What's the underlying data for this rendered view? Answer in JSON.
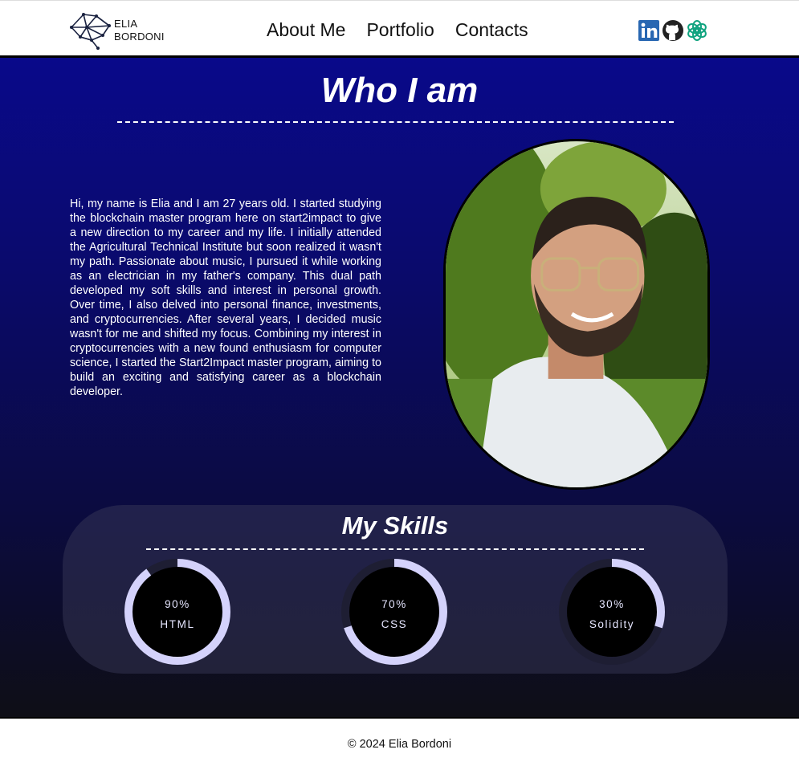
{
  "header": {
    "logo": {
      "line1": "ELIA",
      "line2": "BORDONI"
    },
    "nav": [
      {
        "label": "About Me"
      },
      {
        "label": "Portfolio"
      },
      {
        "label": "Contacts"
      }
    ],
    "socials": [
      {
        "icon": "linkedin-icon",
        "color": "#2867b2"
      },
      {
        "icon": "github-icon",
        "color": "#222222"
      },
      {
        "icon": "openai-icon",
        "color": "#10a37f"
      }
    ]
  },
  "about": {
    "title": "Who I am",
    "bio": "Hi, my name is Elia and I am 27 years old. I started studying the blockchain master program here on start2impact to give a new direction to my career and my life. I initially attended the Agricultural Technical Institute but soon realized it wasn't my path. Passionate about music, I pursued it while working as an electrician in my father's company. This dual path developed my soft skills and interest in personal growth. Over time, I also delved into personal finance, investments, and cryptocurrencies. After several years, I decided music wasn't for me and shifted my focus. Combining my interest in cryptocurrencies with a new found enthusiasm for computer science, I started the Start2Impact master program, aiming to build an exciting and satisfying career as a blockchain developer."
  },
  "skills": {
    "title": "My Skills",
    "items": [
      {
        "percent_label": "90%",
        "name": "HTML",
        "value": 0.9
      },
      {
        "percent_label": "70%",
        "name": "CSS",
        "value": 0.7
      },
      {
        "percent_label": "30%",
        "name": "Solidity",
        "value": 0.3
      }
    ],
    "ring_color": "#d4d2fb",
    "track_color": "#1e1e33"
  },
  "footer": {
    "text": "© 2024 Elia Bordoni"
  }
}
